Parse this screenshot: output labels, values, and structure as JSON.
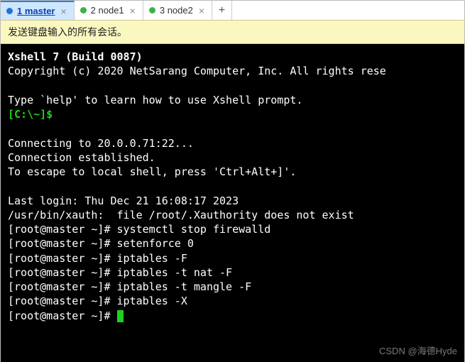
{
  "tabs": [
    {
      "label": "1 master",
      "dot_color": "#1c74d8",
      "active": true
    },
    {
      "label": "2 node1",
      "dot_color": "#3bb24a",
      "active": false
    },
    {
      "label": "3 node2",
      "dot_color": "#3bb24a",
      "active": false
    }
  ],
  "addtab_glyph": "+",
  "close_glyph": "×",
  "notice": "发送键盘输入的所有会话。",
  "term": {
    "banner": "Xshell 7 (Build 0087)",
    "copyright": "Copyright (c) 2020 NetSarang Computer, Inc. All rights rese",
    "helpline": "Type `help' to learn how to use Xshell prompt.",
    "local_prompt": "[C:\\~]$",
    "connecting": "Connecting to 20.0.0.71:22...",
    "established": "Connection established.",
    "escape": "To escape to local shell, press 'Ctrl+Alt+]'.",
    "lastlogin": "Last login: Thu Dec 21 16:08:17 2023",
    "xauth": "/usr/bin/xauth:  file /root/.Xauthority does not exist",
    "prompt": "[root@master ~]#",
    "commands": [
      "systemctl stop firewalld",
      "setenforce 0",
      "iptables -F",
      "iptables -t nat -F",
      "iptables -t mangle -F",
      "iptables -X"
    ]
  },
  "watermark": "CSDN @海德Hyde"
}
